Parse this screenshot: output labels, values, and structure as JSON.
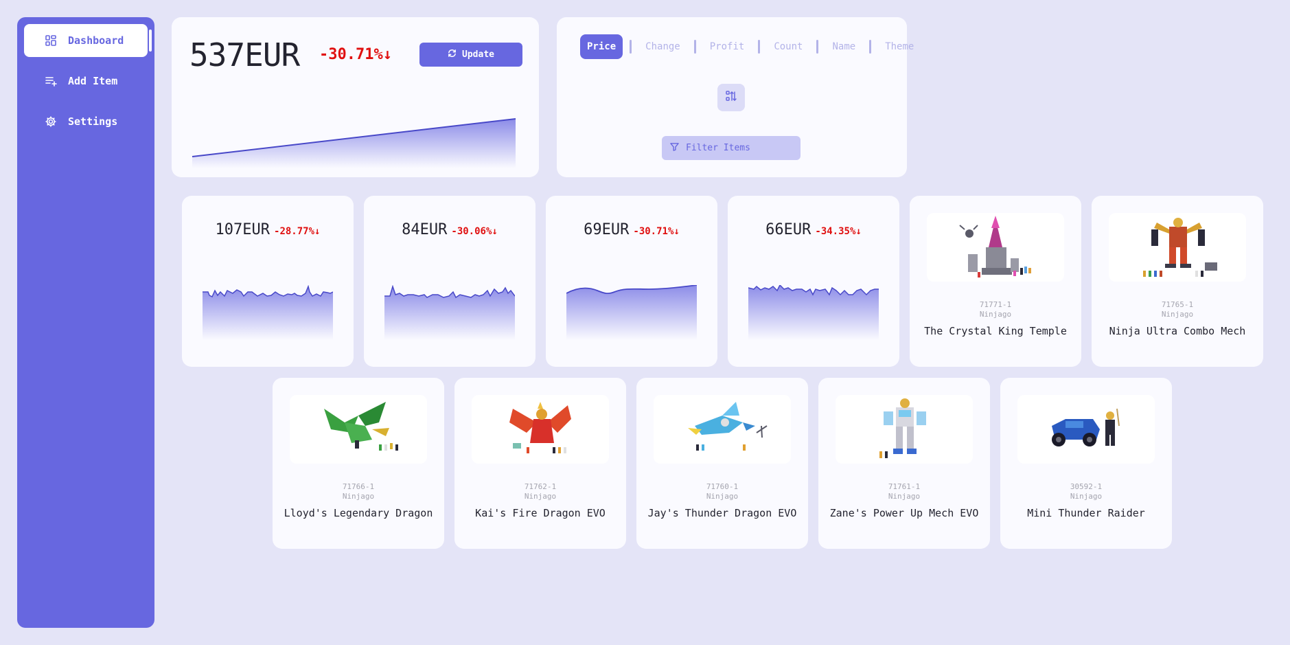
{
  "sidebar": {
    "items": [
      {
        "label": "Dashboard",
        "icon": "dashboard-icon",
        "active": true
      },
      {
        "label": "Add Item",
        "icon": "add-list-icon",
        "active": false
      },
      {
        "label": "Settings",
        "icon": "gear-icon",
        "active": false
      }
    ]
  },
  "summary": {
    "total": "537EUR",
    "change": "-30.71%↓",
    "update_label": "Update"
  },
  "sort": {
    "tabs": [
      "Price",
      "Change",
      "Profit",
      "Count",
      "Name",
      "Theme"
    ],
    "active": "Price",
    "filter_label": "Filter Items"
  },
  "stats": [
    {
      "price": "107EUR",
      "change": "-28.77%↓"
    },
    {
      "price": "84EUR",
      "change": "-30.06%↓"
    },
    {
      "price": "69EUR",
      "change": "-30.71%↓"
    },
    {
      "price": "66EUR",
      "change": "-34.35%↓"
    }
  ],
  "items": [
    {
      "set": "71771-1",
      "theme": "Ninjago",
      "name": "The Crystal King Temple"
    },
    {
      "set": "71765-1",
      "theme": "Ninjago",
      "name": "Ninja Ultra Combo Mech"
    },
    {
      "set": "71766-1",
      "theme": "Ninjago",
      "name": "Lloyd's Legendary Dragon"
    },
    {
      "set": "71762-1",
      "theme": "Ninjago",
      "name": "Kai's Fire Dragon EVO"
    },
    {
      "set": "71760-1",
      "theme": "Ninjago",
      "name": "Jay's Thunder Dragon EVO"
    },
    {
      "set": "71761-1",
      "theme": "Ninjago",
      "name": "Zane's Power Up Mech EVO"
    },
    {
      "set": "30592-1",
      "theme": "Ninjago",
      "name": "Mini Thunder Raider"
    }
  ],
  "colors": {
    "accent": "#6767e0",
    "negative": "#e01010",
    "background": "#e4e4f7"
  }
}
